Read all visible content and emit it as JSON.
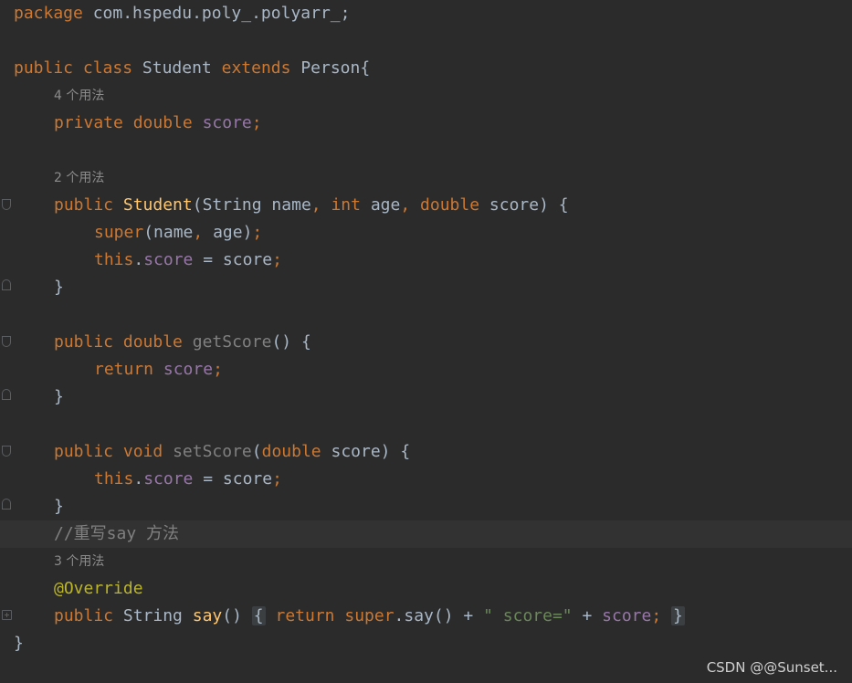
{
  "editor": {
    "package_line": {
      "kw": "package",
      "name": "com.hspedu.poly_.polyarr_;"
    },
    "class_decl": {
      "kw_public": "public",
      "kw_class": "class",
      "name": "Student",
      "kw_extends": "extends",
      "parent": "Person{"
    },
    "hint_4_usages": "4 个用法",
    "field_line": {
      "kw_private": "private",
      "kw_double": "double",
      "name": "score",
      "semi": ";"
    },
    "hint_2_usages": "2 个用法",
    "constructor": {
      "kw_public": "public",
      "name": "Student",
      "params_start": "(String name",
      "comma1": ",",
      "kw_int": "int",
      "age_param": "age",
      "comma2": ",",
      "kw_double": "double",
      "score_param": "score) {"
    },
    "super_line": {
      "kw_super": "super",
      "args": "(name",
      "comma": ",",
      "rest": "age)",
      "semi": ";"
    },
    "this_score_1": {
      "kw_this": "this",
      "dot": ".",
      "field": "score",
      "rest": "= score",
      "semi": ";"
    },
    "close_brace": "}",
    "get_score": {
      "kw_public": "public",
      "kw_double": "double",
      "name": "getScore",
      "rest": "() {"
    },
    "return_score": {
      "kw_return": "return",
      "field": "score",
      "semi": ";"
    },
    "set_score": {
      "kw_public": "public",
      "kw_void": "void",
      "name": "setScore",
      "paren_open": "(",
      "kw_double": "double",
      "rest": "score) {"
    },
    "comment_line": "//重写say 方法",
    "hint_3_usages": "3 个用法",
    "annotation": "@Override",
    "say_line": {
      "kw_public": "public",
      "type": "String",
      "name": "say",
      "parens": "()",
      "open_brace": "{",
      "kw_return": "return",
      "kw_super": "super",
      "call": ".say() + ",
      "string": "\" score=\"",
      "plus": " + ",
      "field": "score",
      "semi": ";",
      "close_brace": "}"
    },
    "class_close": "}"
  },
  "watermark": "CSDN @@Sunset..."
}
